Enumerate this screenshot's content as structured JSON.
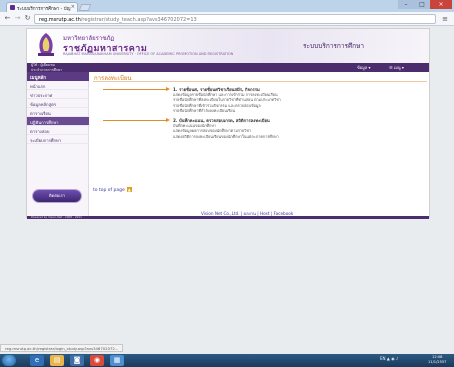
{
  "browser": {
    "tab_title": "ระบบบริการการศึกษา - บัญ",
    "tab_close": "×",
    "address_host": "reg.msrutp.ac.th",
    "address_path": "/registrar/study_teach.asp?avs346702072=13",
    "window_min": "–",
    "window_max": "□",
    "window_close": "×",
    "menu": "≡"
  },
  "header": {
    "uni_thai_small": "มหาวิทยาลัยราชภัฏ",
    "uni_name": "ราชภัฏมหาสารคาม",
    "uni_english": "RAJABHAT MAHASARAKHAM UNIVERSITY · OFFICE OF ACADEMIC PROMOTION AND REGISTRATION",
    "service_title": "ระบบบริการการศึกษา"
  },
  "subbar": {
    "user_line1": "ผู้ใช้ : ผู้เยี่ยมชม",
    "user_line2": "ประจำภาคการศึกษา",
    "menu_a": "ข้อมูล ▾",
    "menu_b": "☰ เมนู ▾"
  },
  "sidebar": {
    "heading": "เมนูหลัก",
    "items": [
      {
        "label": "หน้าแรก",
        "active": false
      },
      {
        "label": "ข่าวประกาศ",
        "active": false
      },
      {
        "label": "ข้อมูลหลักสูตร",
        "active": false
      },
      {
        "label": "ตารางเรียน",
        "active": false
      },
      {
        "label": "ปฏิทินการศึกษา",
        "active": true
      },
      {
        "label": "ตารางสอบ",
        "active": false
      },
      {
        "label": "ระเบียบการศึกษา",
        "active": false
      }
    ],
    "badge": "ติดต่อเรา"
  },
  "content": {
    "page_title": "การลงทะเบียน",
    "section1_title": "1. รายชื่อนศ, รายชื่อนศวิชาเรียนสมีร, กิจกรรม",
    "section1_desc": [
      "แสดงข้อมูลรายชื่อนักศึกษา และการเข้าร่วม การลงทะเบียนเรียน",
      "รายชื่อนักศึกษาที่ลงทะเบียนในรายวิชาที่ท่านสอน ตามประเภทวิชา",
      "รายชื่อนักศึกษาที่เข้าร่วมกิจกรรม และตรวจสอบข้อมูล",
      "รายชื่อนักศึกษาที่กำลังลงทะเบียนเรียน"
    ],
    "section2_title": "2. บันทึกคะแนน, ตรวจสอบเกรด, สถิติการลงทะเบียน",
    "section2_desc": [
      "บันทึกคะแนนของนักศึกษา",
      "แสดงข้อมูลผลการสอบของนักศึกษาตามรายวิชา",
      "แสดงสถิติการลงทะเบียนเรียนของนักศึกษาในแต่ละภาคการศึกษา"
    ],
    "top_link": "to top of page",
    "top_arrow": "▲",
    "footer_links": "Vision Net Co.,Ltd. | ผลงาน | Host | Facebook"
  },
  "bottom": {
    "credit": "Powered by Vision Net · 2008 - 2011"
  },
  "status": {
    "url": "reg.msrutp.ac.th/registrar/login_study.asp?avs346702072..."
  },
  "taskbar": {
    "icons": [
      "ie-icon",
      "explorer-icon",
      "outlook-icon",
      "chrome-icon",
      "paint-icon"
    ],
    "tray": "EN  ▲  ◉  ♪",
    "time": "12:08",
    "date": "11/1/2557"
  }
}
